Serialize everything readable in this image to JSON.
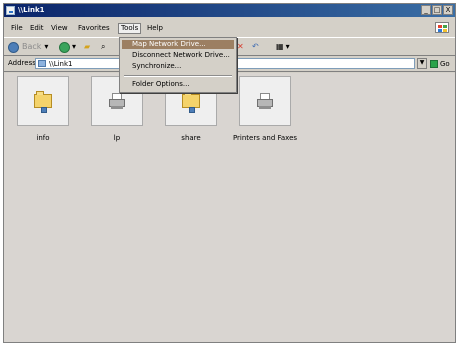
{
  "window": {
    "title": "\\\\Link1",
    "controls": [
      "_",
      "□",
      "X"
    ]
  },
  "menu": {
    "items": [
      "File",
      "Edit",
      "View",
      "Favorites",
      "Tools",
      "Help"
    ]
  },
  "toolbar": {
    "back_label": "Back"
  },
  "address": {
    "label": "Address",
    "value": "\\\\Link1",
    "go_label": "Go"
  },
  "files": [
    {
      "label": "info"
    },
    {
      "label": "lp"
    },
    {
      "label": "share"
    },
    {
      "label": "Printers and Faxes"
    }
  ],
  "tools_menu": {
    "items": [
      "Map Network Drive...",
      "Disconnect Network Drive...",
      "Synchronize...",
      "Folder Options..."
    ]
  },
  "colors": {
    "title_start": "#0a246a",
    "title_end": "#3a6ea5",
    "window_bg": "#d4d0c8",
    "content_bg": "#d9d5d1",
    "menu_hover": "#9c7f62"
  }
}
